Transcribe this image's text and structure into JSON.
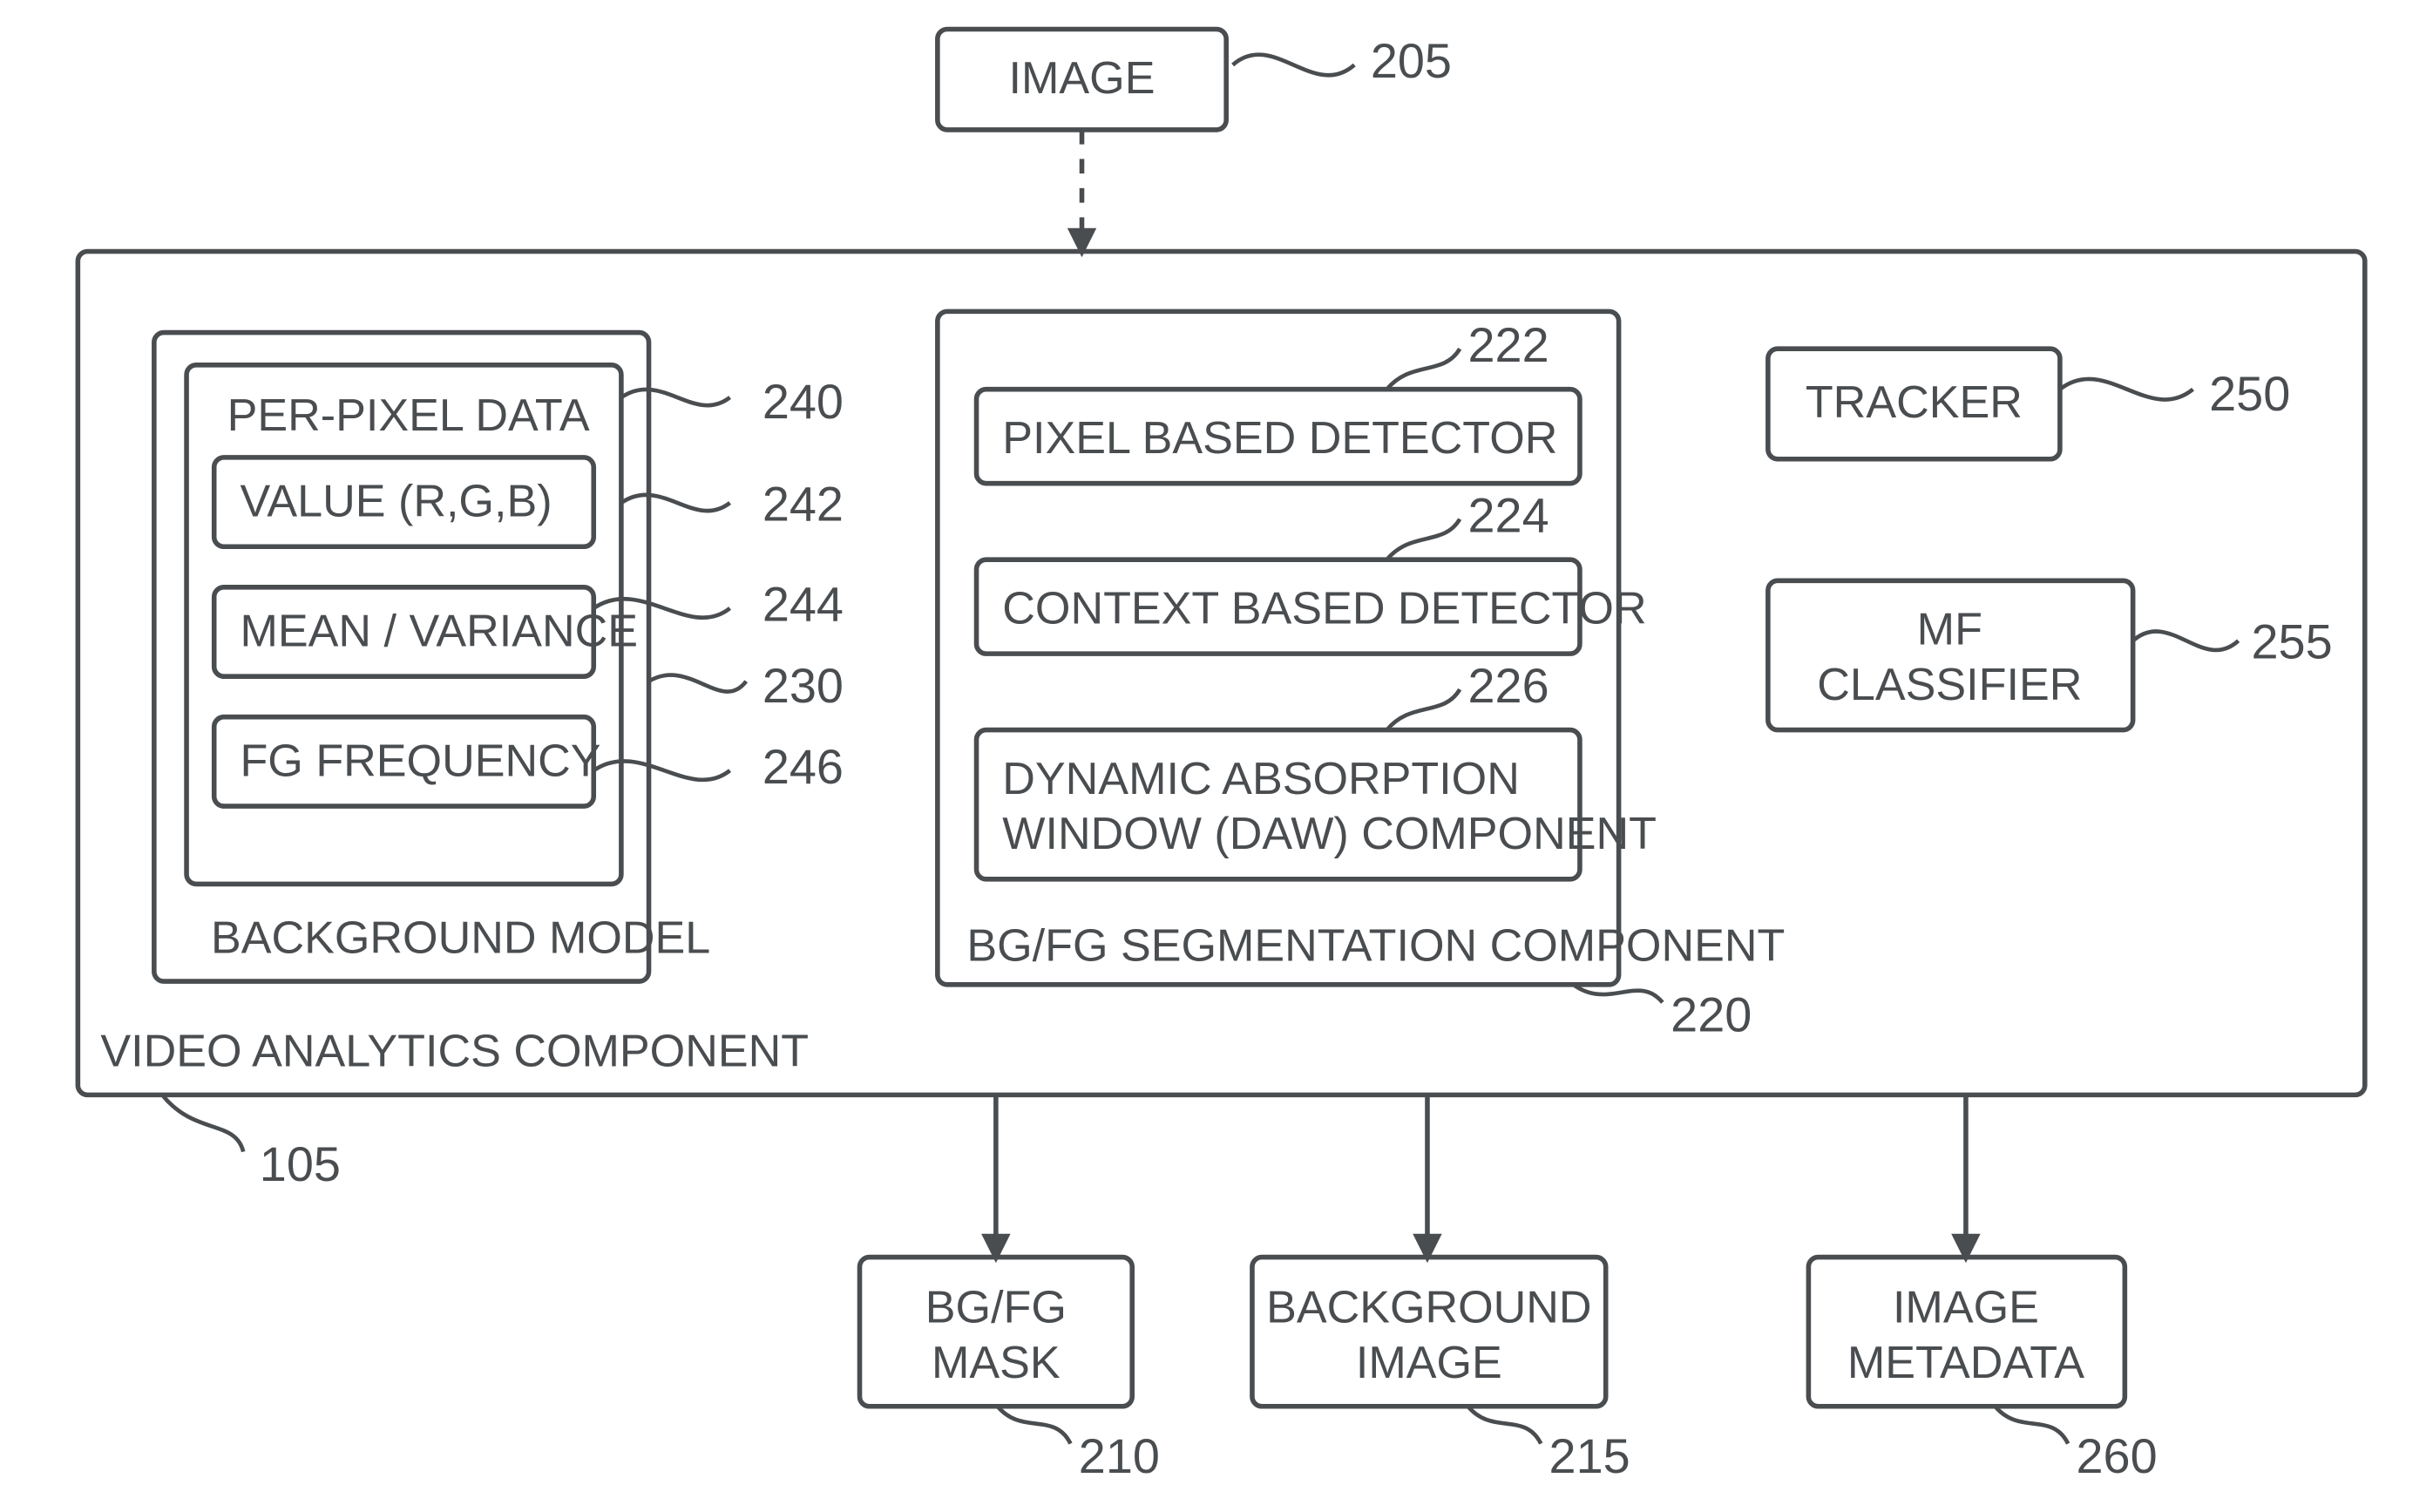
{
  "top": {
    "image": "IMAGE"
  },
  "main": {
    "title": "VIDEO ANALYTICS COMPONENT",
    "bgModel": {
      "title": "BACKGROUND MODEL",
      "ppd": {
        "title": "PER-PIXEL DATA",
        "value": "VALUE (R,G,B)",
        "meanvar": "MEAN / VARIANCE",
        "fgfreq": "FG FREQUENCY"
      }
    },
    "seg": {
      "title": "BG/FG SEGMENTATION COMPONENT",
      "pixel": "PIXEL BASED DETECTOR",
      "context": "CONTEXT BASED DETECTOR",
      "daw1": "DYNAMIC ABSORPTION",
      "daw2": "WINDOW (DAW) COMPONENT"
    },
    "tracker": "TRACKER",
    "mf1": "MF",
    "mf2": "CLASSIFIER"
  },
  "out": {
    "mask1": "BG/FG",
    "mask2": "MASK",
    "bgimg1": "BACKGROUND",
    "bgimg2": "IMAGE",
    "meta1": "IMAGE",
    "meta2": "METADATA"
  },
  "nums": {
    "n205": "205",
    "n105": "105",
    "n230": "230",
    "n240": "240",
    "n242": "242",
    "n244": "244",
    "n246": "246",
    "n220": "220",
    "n222": "222",
    "n224": "224",
    "n226": "226",
    "n250": "250",
    "n255": "255",
    "n210": "210",
    "n215": "215",
    "n260": "260"
  }
}
